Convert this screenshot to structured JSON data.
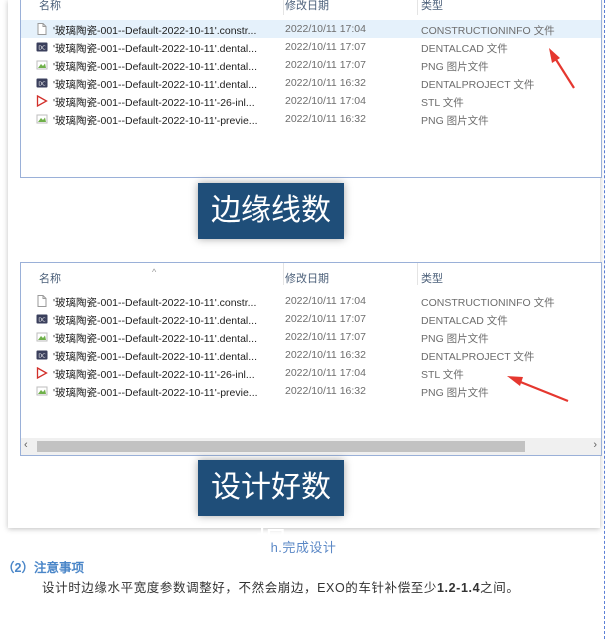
{
  "columns": {
    "name": "名称",
    "modified": "修改日期",
    "type": "类型"
  },
  "files_top": [
    {
      "icon": "blank-file-icon",
      "name": "'玻璃陶瓷-001--Default-2022-10-11'.constr...",
      "modified": "2022/10/11 17:04",
      "type": "CONSTRUCTIONINFO 文件"
    },
    {
      "icon": "dentalcad-icon",
      "name": "'玻璃陶瓷-001--Default-2022-10-11'.dental...",
      "modified": "2022/10/11 17:07",
      "type": "DENTALCAD 文件"
    },
    {
      "icon": "png-image-icon",
      "name": "'玻璃陶瓷-001--Default-2022-10-11'.dental...",
      "modified": "2022/10/11 17:07",
      "type": "PNG 图片文件"
    },
    {
      "icon": "dentalcad-icon",
      "name": "'玻璃陶瓷-001--Default-2022-10-11'.dental...",
      "modified": "2022/10/11 16:32",
      "type": "DENTALPROJECT 文件"
    },
    {
      "icon": "stl-file-icon",
      "name": "'玻璃陶瓷-001--Default-2022-10-11'-26-inl...",
      "modified": "2022/10/11 17:04",
      "type": "STL 文件"
    },
    {
      "icon": "png-image-icon",
      "name": "'玻璃陶瓷-001--Default-2022-10-11'-previe...",
      "modified": "2022/10/11 16:32",
      "type": "PNG 图片文件"
    }
  ],
  "files_bottom": [
    {
      "icon": "blank-file-icon",
      "name": "'玻璃陶瓷-001--Default-2022-10-11'.constr...",
      "modified": "2022/10/11 17:04",
      "type": "CONSTRUCTIONINFO 文件"
    },
    {
      "icon": "dentalcad-icon",
      "name": "'玻璃陶瓷-001--Default-2022-10-11'.dental...",
      "modified": "2022/10/11 17:07",
      "type": "DENTALCAD 文件"
    },
    {
      "icon": "png-image-icon",
      "name": "'玻璃陶瓷-001--Default-2022-10-11'.dental...",
      "modified": "2022/10/11 17:07",
      "type": "PNG 图片文件"
    },
    {
      "icon": "dentalcad-icon",
      "name": "'玻璃陶瓷-001--Default-2022-10-11'.dental...",
      "modified": "2022/10/11 16:32",
      "type": "DENTALPROJECT 文件"
    },
    {
      "icon": "stl-file-icon",
      "name": "'玻璃陶瓷-001--Default-2022-10-11'-26-inl...",
      "modified": "2022/10/11 17:04",
      "type": "STL 文件"
    },
    {
      "icon": "png-image-icon",
      "name": "'玻璃陶瓷-001--Default-2022-10-11'-previe...",
      "modified": "2022/10/11 16:32",
      "type": "PNG 图片文件"
    }
  ],
  "selected_row_top": 0,
  "banner_top": "边缘线数据",
  "banner_bottom": "设计好数据",
  "caption": "h.完成设计",
  "note_heading": "（2）注意事项",
  "note_text_before": "设计时边缘水平宽度参数调整好，不然会崩边，EXO的车针补偿至少",
  "note_text_bold": "1.2-1.4",
  "note_text_after": "之间。",
  "colors": {
    "banner_bg": "#1f4e79",
    "arrow": "#e5372f",
    "selection": "#e5f1fb",
    "accent": "#4a86c8"
  }
}
